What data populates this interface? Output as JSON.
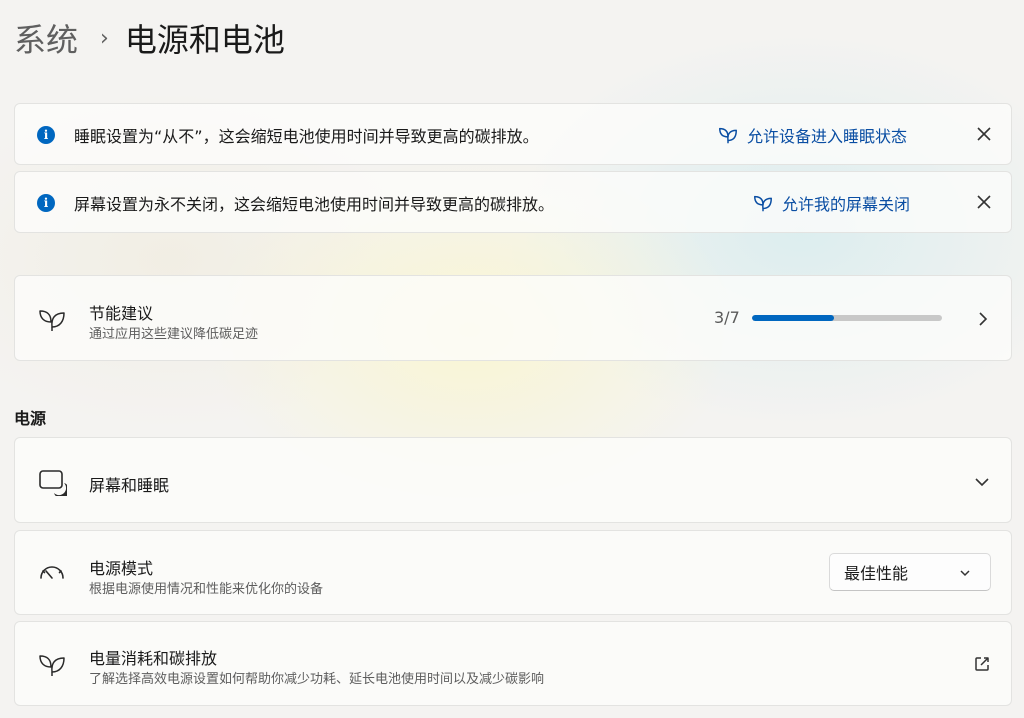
{
  "breadcrumb": {
    "parent": "系统",
    "separator": "›",
    "current": "电源和电池"
  },
  "banners": [
    {
      "message": "睡眠设置为“从不”，这会缩短电池使用时间并导致更高的碳排放。",
      "action": "允许设备进入睡眠状态",
      "icon": "leaf-icon",
      "close_icon": "close-icon"
    },
    {
      "message": "屏幕设置为永不关闭，这会缩短电池使用时间并导致更高的碳排放。",
      "action": "允许我的屏幕关闭",
      "icon": "leaf-icon",
      "close_icon": "close-icon"
    }
  ],
  "energy_recommendations": {
    "title": "节能建议",
    "subtitle": "通过应用这些建议降低碳足迹",
    "progress_label": "3/7",
    "progress_fraction": 0.43,
    "icon": "leaf-icon"
  },
  "power_section": {
    "label": "电源",
    "items": [
      {
        "title": "屏幕和睡眠",
        "icon": "screen-sleep-icon",
        "control": "chevron-down-icon"
      },
      {
        "title": "电源模式",
        "subtitle": "根据电源使用情况和性能来优化你的设备",
        "icon": "gauge-icon",
        "dropdown_value": "最佳性能"
      },
      {
        "title": "电量消耗和碳排放",
        "subtitle": "了解选择高效电源设置如何帮助你减少功耗、延长电池使用时间以及减少碳影响",
        "icon": "leaf-icon",
        "control": "external-link-icon"
      }
    ]
  },
  "colors": {
    "accent": "#0067c0",
    "link": "#0a4ea3",
    "track": "#c8c8c8"
  }
}
